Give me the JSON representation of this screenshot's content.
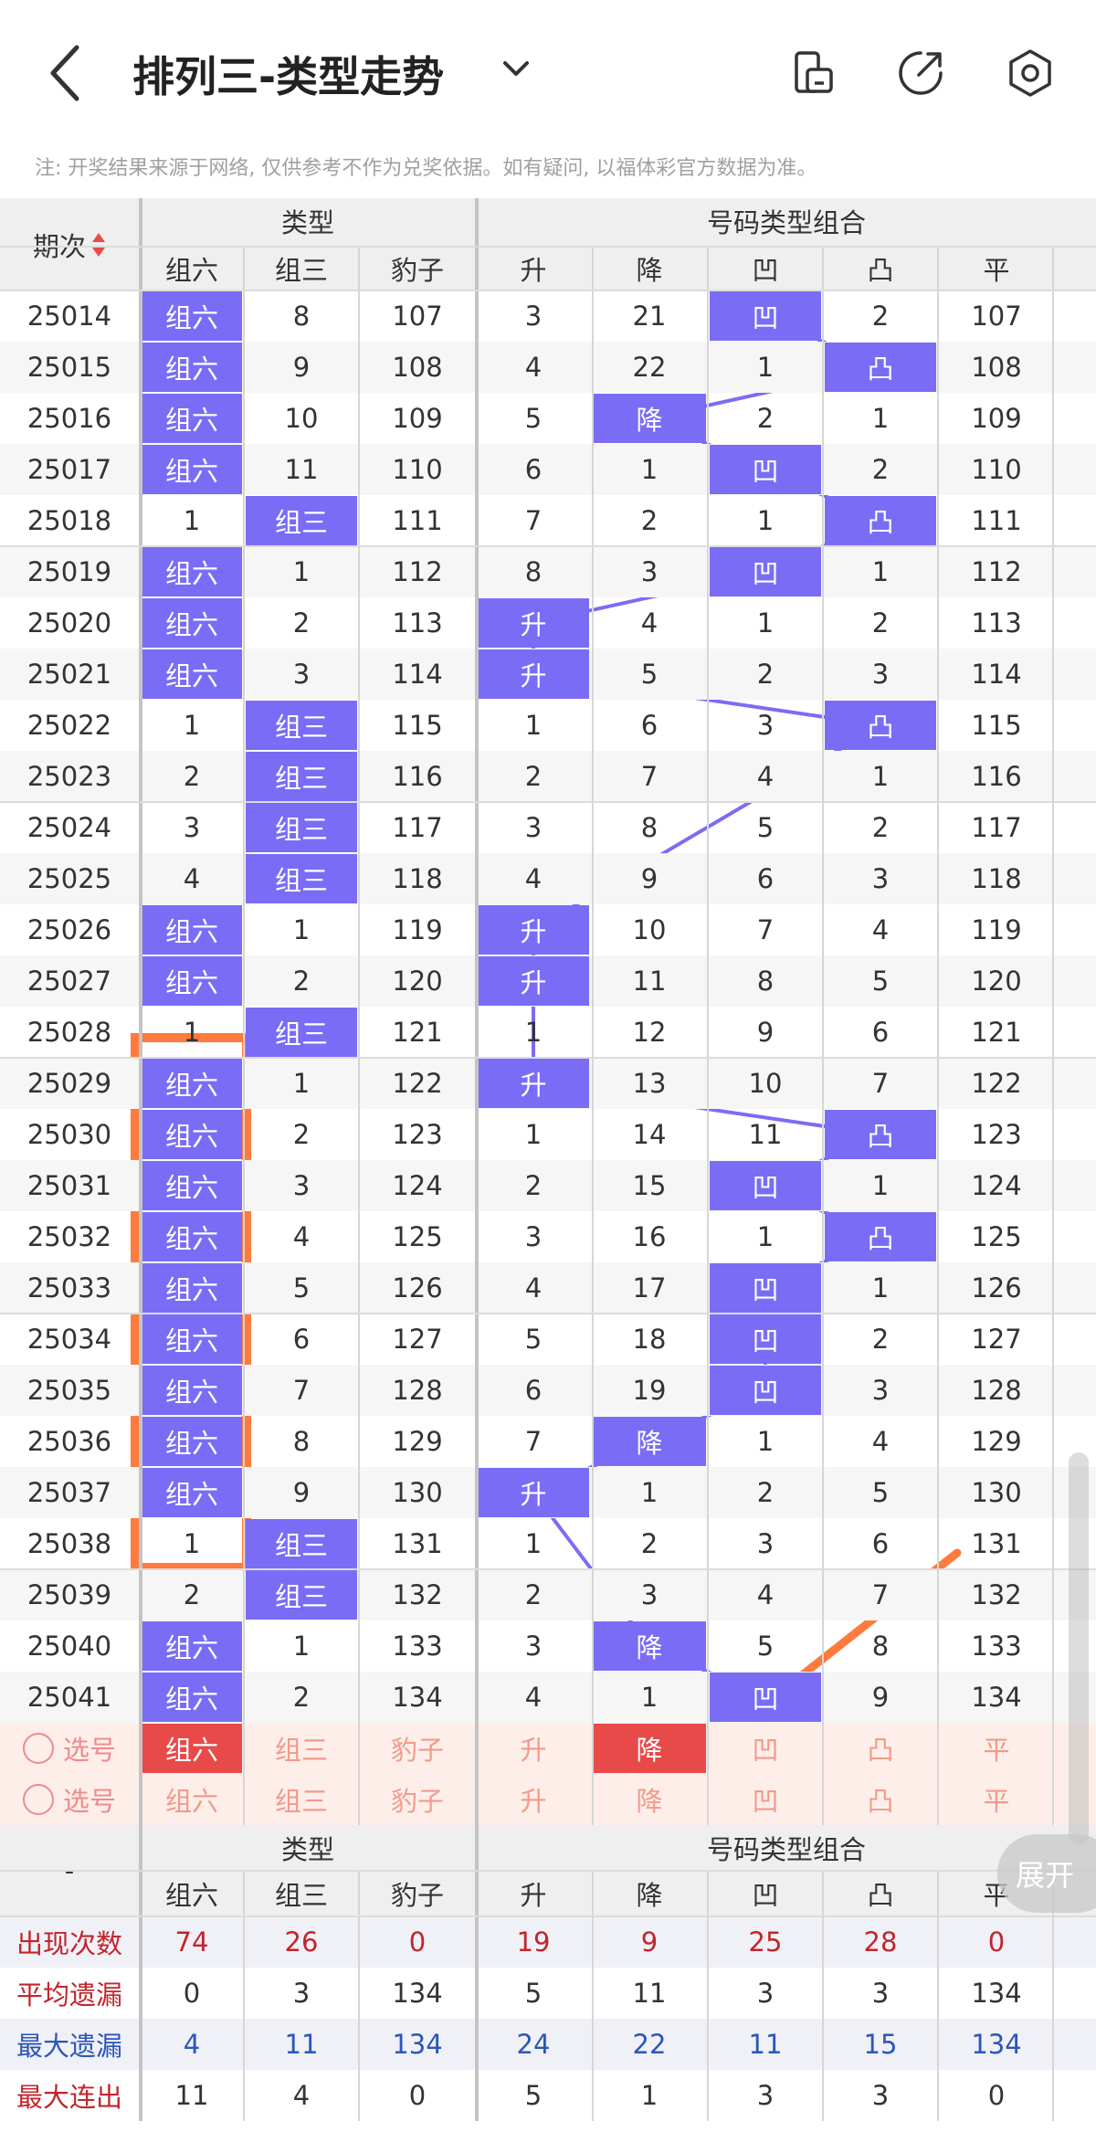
{
  "header": {
    "title": "排列三-类型走势",
    "icons": [
      "back-arrow-icon",
      "chevron-down-icon",
      "document-icon",
      "share-icon",
      "settings-gear-icon"
    ]
  },
  "note": "注: 开奖结果来源于网络, 仅供参考不作为兑奖依据。如有疑问, 以福体彩官方数据为准。",
  "table": {
    "period_header": "期次",
    "group_headers": [
      "类型",
      "号码类型组合"
    ],
    "columns": [
      "组六",
      "组三",
      "豹子",
      "升",
      "降",
      "凹",
      "凸",
      "平"
    ],
    "rows": [
      {
        "p": "25014",
        "v": [
          "组六",
          "8",
          "107",
          "3",
          "21",
          "凹",
          "2",
          "107"
        ]
      },
      {
        "p": "25015",
        "v": [
          "组六",
          "9",
          "108",
          "4",
          "22",
          "1",
          "凸",
          "108"
        ]
      },
      {
        "p": "25016",
        "v": [
          "组六",
          "10",
          "109",
          "5",
          "降",
          "2",
          "1",
          "109"
        ]
      },
      {
        "p": "25017",
        "v": [
          "组六",
          "11",
          "110",
          "6",
          "1",
          "凹",
          "2",
          "110"
        ]
      },
      {
        "p": "25018",
        "v": [
          "1",
          "组三",
          "111",
          "7",
          "2",
          "1",
          "凸",
          "111"
        ]
      },
      {
        "p": "25019",
        "v": [
          "组六",
          "1",
          "112",
          "8",
          "3",
          "凹",
          "1",
          "112"
        ]
      },
      {
        "p": "25020",
        "v": [
          "组六",
          "2",
          "113",
          "升",
          "4",
          "1",
          "2",
          "113"
        ]
      },
      {
        "p": "25021",
        "v": [
          "组六",
          "3",
          "114",
          "升",
          "5",
          "2",
          "3",
          "114"
        ]
      },
      {
        "p": "25022",
        "v": [
          "1",
          "组三",
          "115",
          "1",
          "6",
          "3",
          "凸",
          "115"
        ]
      },
      {
        "p": "25023",
        "v": [
          "2",
          "组三",
          "116",
          "2",
          "7",
          "4",
          "1",
          "116"
        ]
      },
      {
        "p": "25024",
        "v": [
          "3",
          "组三",
          "117",
          "3",
          "8",
          "5",
          "2",
          "117"
        ]
      },
      {
        "p": "25025",
        "v": [
          "4",
          "组三",
          "118",
          "4",
          "9",
          "6",
          "3",
          "118"
        ]
      },
      {
        "p": "25026",
        "v": [
          "组六",
          "1",
          "119",
          "升",
          "10",
          "7",
          "4",
          "119"
        ]
      },
      {
        "p": "25027",
        "v": [
          "组六",
          "2",
          "120",
          "升",
          "11",
          "8",
          "5",
          "120"
        ]
      },
      {
        "p": "25028",
        "v": [
          "1",
          "组三",
          "121",
          "1",
          "12",
          "9",
          "6",
          "121"
        ]
      },
      {
        "p": "25029",
        "v": [
          "组六",
          "1",
          "122",
          "升",
          "13",
          "10",
          "7",
          "122"
        ]
      },
      {
        "p": "25030",
        "v": [
          "组六",
          "2",
          "123",
          "1",
          "14",
          "11",
          "凸",
          "123"
        ]
      },
      {
        "p": "25031",
        "v": [
          "组六",
          "3",
          "124",
          "2",
          "15",
          "凹",
          "1",
          "124"
        ]
      },
      {
        "p": "25032",
        "v": [
          "组六",
          "4",
          "125",
          "3",
          "16",
          "1",
          "凸",
          "125"
        ]
      },
      {
        "p": "25033",
        "v": [
          "组六",
          "5",
          "126",
          "4",
          "17",
          "凹",
          "1",
          "126"
        ]
      },
      {
        "p": "25034",
        "v": [
          "组六",
          "6",
          "127",
          "5",
          "18",
          "凹",
          "2",
          "127"
        ]
      },
      {
        "p": "25035",
        "v": [
          "组六",
          "7",
          "128",
          "6",
          "19",
          "凹",
          "3",
          "128"
        ]
      },
      {
        "p": "25036",
        "v": [
          "组六",
          "8",
          "129",
          "7",
          "降",
          "1",
          "4",
          "129"
        ]
      },
      {
        "p": "25037",
        "v": [
          "组六",
          "9",
          "130",
          "升",
          "1",
          "2",
          "5",
          "130"
        ]
      },
      {
        "p": "25038",
        "v": [
          "1",
          "组三",
          "131",
          "1",
          "2",
          "3",
          "6",
          "131"
        ]
      },
      {
        "p": "25039",
        "v": [
          "2",
          "组三",
          "132",
          "2",
          "3",
          "4",
          "7",
          "132"
        ]
      },
      {
        "p": "25040",
        "v": [
          "组六",
          "1",
          "133",
          "3",
          "降",
          "5",
          "8",
          "133"
        ]
      },
      {
        "p": "25041",
        "v": [
          "组六",
          "2",
          "134",
          "4",
          "1",
          "凹",
          "9",
          "134"
        ]
      }
    ],
    "select_rows": [
      {
        "label": "选号",
        "v": [
          "组六",
          "组三",
          "豹子",
          "升",
          "降",
          "凹",
          "凸",
          "平"
        ],
        "active": [
          0,
          4
        ]
      },
      {
        "label": "选号",
        "v": [
          "组六",
          "组三",
          "豹子",
          "升",
          "降",
          "凹",
          "凸",
          "平"
        ],
        "active": []
      }
    ],
    "stats_header_left": "-",
    "stats": [
      {
        "label": "出现次数",
        "color": "red",
        "v": [
          "74",
          "26",
          "0",
          "19",
          "9",
          "25",
          "28",
          "0"
        ]
      },
      {
        "label": "平均遗漏",
        "color": "red",
        "v": [
          "0",
          "3",
          "134",
          "5",
          "11",
          "3",
          "3",
          "134"
        ]
      },
      {
        "label": "最大遗漏",
        "color": "blue",
        "v": [
          "4",
          "11",
          "134",
          "24",
          "22",
          "11",
          "15",
          "134"
        ]
      },
      {
        "label": "最大连出",
        "color": "red",
        "v": [
          "11",
          "4",
          "0",
          "5",
          "1",
          "3",
          "3",
          "0"
        ]
      }
    ]
  },
  "expand_button": "展开",
  "colors": {
    "highlight": "#7b6cf6",
    "select_active": "#e84a4a",
    "annotation": "#ff7a3d"
  }
}
